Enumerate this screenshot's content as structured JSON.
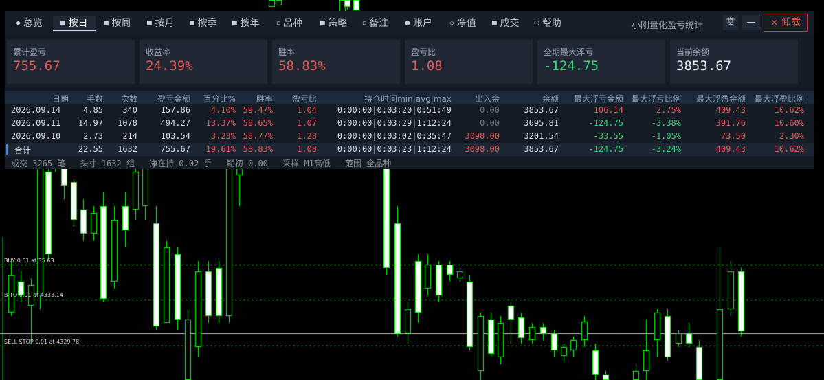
{
  "nav": {
    "tabs": [
      {
        "label": "总览",
        "icon": "diamond-icon",
        "active": false
      },
      {
        "label": "按日",
        "icon": "square-icon",
        "active": true
      },
      {
        "label": "按周",
        "icon": "square-icon",
        "active": false
      },
      {
        "label": "按月",
        "icon": "square-icon",
        "active": false
      },
      {
        "label": "按季",
        "icon": "square-icon",
        "active": false
      },
      {
        "label": "按年",
        "icon": "square-icon",
        "active": false
      },
      {
        "label": "品种",
        "icon": "hollow-square-icon",
        "active": false
      },
      {
        "label": "策略",
        "icon": "square-icon",
        "active": false
      },
      {
        "label": "备注",
        "icon": "hollow-square-icon",
        "active": false
      },
      {
        "label": "账户",
        "icon": "dot-icon",
        "active": false
      },
      {
        "label": "净值",
        "icon": "hollow-diamond-icon",
        "active": false
      },
      {
        "label": "成交",
        "icon": "filled-square-icon",
        "active": false
      },
      {
        "label": "帮助",
        "icon": "circle-icon",
        "active": false
      }
    ],
    "app_title": "小刚量化盈亏统计",
    "reward_label": "赏",
    "minimize_label": "—",
    "close_label": "× 卸载"
  },
  "cards": [
    {
      "label": "累计盈亏",
      "value": "755.67",
      "tone": "red"
    },
    {
      "label": "收益率",
      "value": "24.39%",
      "tone": "red"
    },
    {
      "label": "胜率",
      "value": "58.83%",
      "tone": "red"
    },
    {
      "label": "盈亏比",
      "value": "1.08",
      "tone": "red"
    },
    {
      "label": "全期最大浮亏",
      "value": "-124.75",
      "tone": "green"
    },
    {
      "label": "当前余额",
      "value": "3853.67",
      "tone": "white"
    }
  ],
  "table": {
    "headers": [
      "日期",
      "手数",
      "次数",
      "盈亏金额",
      "百分比%",
      "胜率",
      "盈亏比",
      "持仓时间min|avg|max",
      "出入金",
      "余额",
      "最大浮亏金额",
      "最大浮亏比例",
      "最大浮盈金额",
      "最大浮盈比例"
    ],
    "rows": [
      [
        "2026.09.14",
        "4.85",
        "340",
        "157.86",
        "4.10%",
        "59.47%",
        "1.04",
        "0:00:00|0:03:20|0:51:49",
        "0.00",
        "3853.67",
        "106.14",
        "2.75%",
        "409.43",
        "10.62%"
      ],
      [
        "2026.09.11",
        "14.97",
        "1078",
        "494.27",
        "13.37%",
        "58.65%",
        "1.07",
        "0:00:00|0:03:29|1:12:24",
        "0.00",
        "3695.81",
        "-124.75",
        "-3.38%",
        "391.76",
        "10.60%"
      ],
      [
        "2026.09.10",
        "2.73",
        "214",
        "103.54",
        "3.23%",
        "58.77%",
        "1.28",
        "0:00:00|0:03:02|0:35:47",
        "3098.00",
        "3201.54",
        "-33.55",
        "-1.05%",
        "73.50",
        "2.30%"
      ]
    ],
    "total": [
      "合计",
      "22.55",
      "1632",
      "755.67",
      "19.61%",
      "58.83%",
      "1.08",
      "0:00:00|0:03:23|1:12:24",
      "3098.00",
      "3853.67",
      "-124.75",
      "-3.24%",
      "409.43",
      "10.62%"
    ]
  },
  "footer": {
    "trades": "成交 3265 笔",
    "positions": "头寸 1632 组",
    "net_holding": "净在持 0.02 手",
    "initial": "期初 0.00",
    "sampling": "采样 M1高低",
    "scope": "范围 全品种"
  },
  "chart_labels": {
    "buy": "BUY 0.01 at  35.63",
    "buy2": "B    TO    0.01 at 4333.14",
    "sell": "SELL STOP 0.01 at 4329.78"
  },
  "colors": {
    "up": "#00ff00",
    "down": "#ffffff",
    "red": "#e55a5a",
    "green": "#3ad07a"
  }
}
